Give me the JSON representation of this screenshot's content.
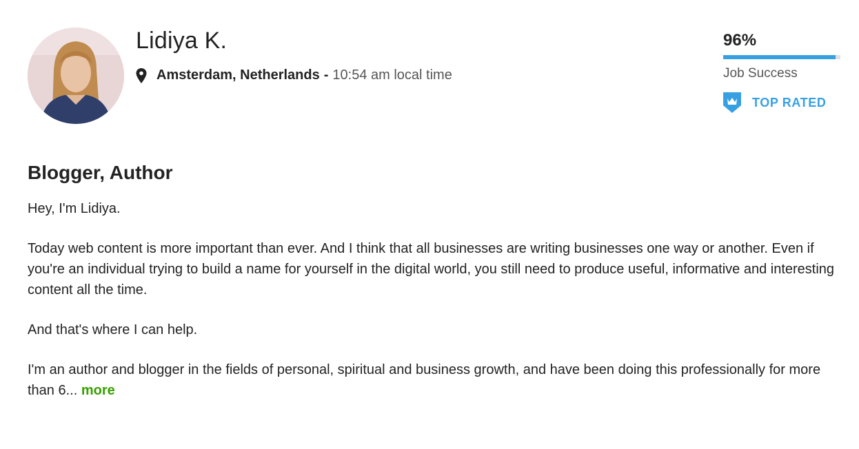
{
  "profile": {
    "name": "Lidiya K.",
    "location": "Amsterdam, Netherlands",
    "separator": "-",
    "local_time": "10:54 am local time"
  },
  "stats": {
    "job_success_pct": "96%",
    "job_success_value": 0.96,
    "job_success_label": "Job Success",
    "badge_label": "TOP RATED",
    "badge_icon": "top-rated-badge-icon",
    "accent_color": "#37a0e3"
  },
  "overview": {
    "title": "Blogger, Author",
    "intro": "Hey, I'm Lidiya.",
    "paragraph1": "Today web content is more important than ever. And I think that all businesses are writing businesses one way or another. Even if you're an individual trying to build a name for yourself in the digital world, you still need to produce useful, informative and interesting content all the time.",
    "paragraph2": "And that's where I can help.",
    "paragraph3": "I'm an author and blogger in the fields of personal, spiritual and business growth, and have been doing this professionally for more than 6...",
    "more_label": "more",
    "more_color": "#37a000"
  },
  "icons": {
    "location": "location-pin-icon"
  }
}
